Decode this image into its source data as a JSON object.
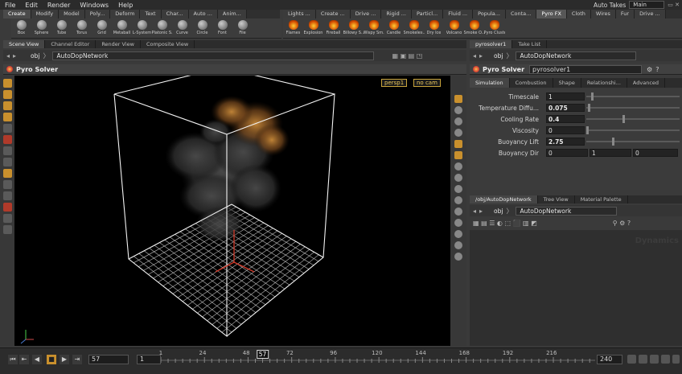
{
  "menu": {
    "items": [
      "File",
      "Edit",
      "Render",
      "Windows",
      "Help"
    ],
    "auto_takes": "Auto Takes",
    "desktop": "Main"
  },
  "shelf_left": {
    "tabs": [
      "Create",
      "Modify",
      "Model",
      "Poly...",
      "Deform",
      "Text",
      "Char...",
      "Auto ...",
      "Anim..."
    ],
    "tools": [
      "Box",
      "Sphere",
      "Tube",
      "Torus",
      "Grid",
      "Metaball",
      "L-System",
      "Platonic S...",
      "Curve",
      "Circle",
      "Font",
      "File"
    ]
  },
  "shelf_right": {
    "tabs": [
      "Lights ...",
      "Create ...",
      "Drive ...",
      "Rigid ...",
      "Particl...",
      "Fluid ...",
      "Popula...",
      "Conta...",
      "Pyro FX",
      "Cloth",
      "Wires",
      "Fur",
      "Drive ..."
    ],
    "tools": [
      "Flames",
      "Explosion",
      "Fireball",
      "Billowy S...",
      "Wispy Sm...",
      "Candle",
      "Smokeles...",
      "Dry Ice",
      "Volcano",
      "Smoke O...",
      "Pyro Cluster"
    ]
  },
  "left_pane": {
    "tabs": [
      "Scene View",
      "Channel Editor",
      "Render View",
      "Composite View"
    ],
    "path_root": "obj",
    "path_node": "AutoDopNetwork",
    "title": "Pyro Solver",
    "camera": "persp1",
    "cam_mode": "no cam"
  },
  "param_pane": {
    "tabs": [
      "pyrosolver1",
      "Take List"
    ],
    "path_root": "obj",
    "path_node": "AutoDopNetwork",
    "node_type": "Pyro Solver",
    "node_name": "pyrosolver1",
    "sub_tabs": [
      "Simulation",
      "Combustion",
      "Shape",
      "Relationshi...",
      "Advanced"
    ],
    "params": [
      {
        "label": "Timescale",
        "value": "1",
        "slider": 0.05,
        "bold": false
      },
      {
        "label": "Temperature Diffu...",
        "value": "0.075",
        "slider": 0.02,
        "bold": true
      },
      {
        "label": "Cooling Rate",
        "value": "0.4",
        "slider": 0.4,
        "bold": true
      },
      {
        "label": "Viscosity",
        "value": "0",
        "slider": 0.0,
        "bold": false
      },
      {
        "label": "Buoyancy Lift",
        "value": "2.75",
        "slider": 0.28,
        "bold": true
      }
    ],
    "buoyancy_dir": {
      "label": "Buoyancy Dir",
      "x": "0",
      "y": "1",
      "z": "0"
    }
  },
  "net_pane": {
    "tabs": [
      "/obj/AutoDopNetwork",
      "Tree View",
      "Material Palette"
    ],
    "path_root": "obj",
    "path_node": "AutoDopNetwork",
    "watermark": "Dynamics"
  },
  "timeline": {
    "current_frame": "57",
    "start_frame": "1",
    "end_frame": "240",
    "ruler_start": 1,
    "ruler_end": 240,
    "ticks": [
      "1",
      "24",
      "48",
      "72",
      "96",
      "120",
      "144",
      "168",
      "192",
      "216"
    ],
    "tick_values": [
      1,
      24,
      48,
      72,
      96,
      120,
      144,
      168,
      192,
      216
    ],
    "cursor_value": 57,
    "cursor_label": "57"
  },
  "colors": {
    "accent": "#c9902d",
    "viewport_bg": "#000000",
    "grid": "#cfcfcf",
    "axis": "#d13a2a"
  }
}
